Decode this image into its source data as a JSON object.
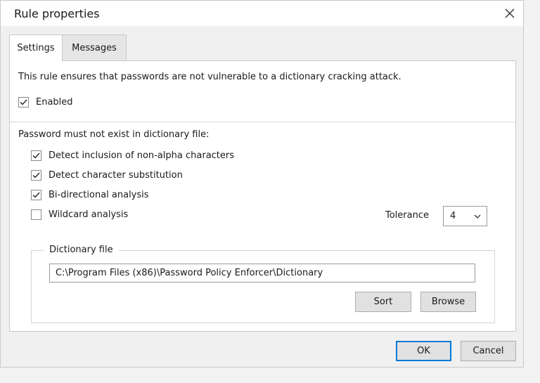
{
  "window": {
    "title": "Rule properties"
  },
  "tabs": [
    {
      "label": "Settings",
      "active": true
    },
    {
      "label": "Messages",
      "active": false
    }
  ],
  "settings": {
    "description": "This rule ensures that passwords are not vulnerable to a dictionary cracking attack.",
    "enabled": {
      "label": "Enabled",
      "checked": true
    },
    "dictionary_heading": "Password must not exist in dictionary file:",
    "options": [
      {
        "label": "Detect inclusion of non-alpha characters",
        "checked": true
      },
      {
        "label": "Detect character substitution",
        "checked": true
      },
      {
        "label": "Bi-directional analysis",
        "checked": true
      },
      {
        "label": "Wildcard analysis",
        "checked": false
      }
    ],
    "tolerance": {
      "label": "Tolerance",
      "value": "4"
    },
    "dictionary_file": {
      "legend": "Dictionary file",
      "path": "C:\\Program Files (x86)\\Password Policy Enforcer\\Dictionary",
      "sort_label": "Sort",
      "browse_label": "Browse"
    }
  },
  "footer": {
    "ok_label": "OK",
    "cancel_label": "Cancel"
  },
  "colors": {
    "accent": "#0078d7",
    "panel": "#ffffff",
    "dialog_bg": "#f0f0f0"
  },
  "icons": {
    "close": "close-icon",
    "check": "check-icon",
    "dropdown": "chevron-down-icon"
  }
}
